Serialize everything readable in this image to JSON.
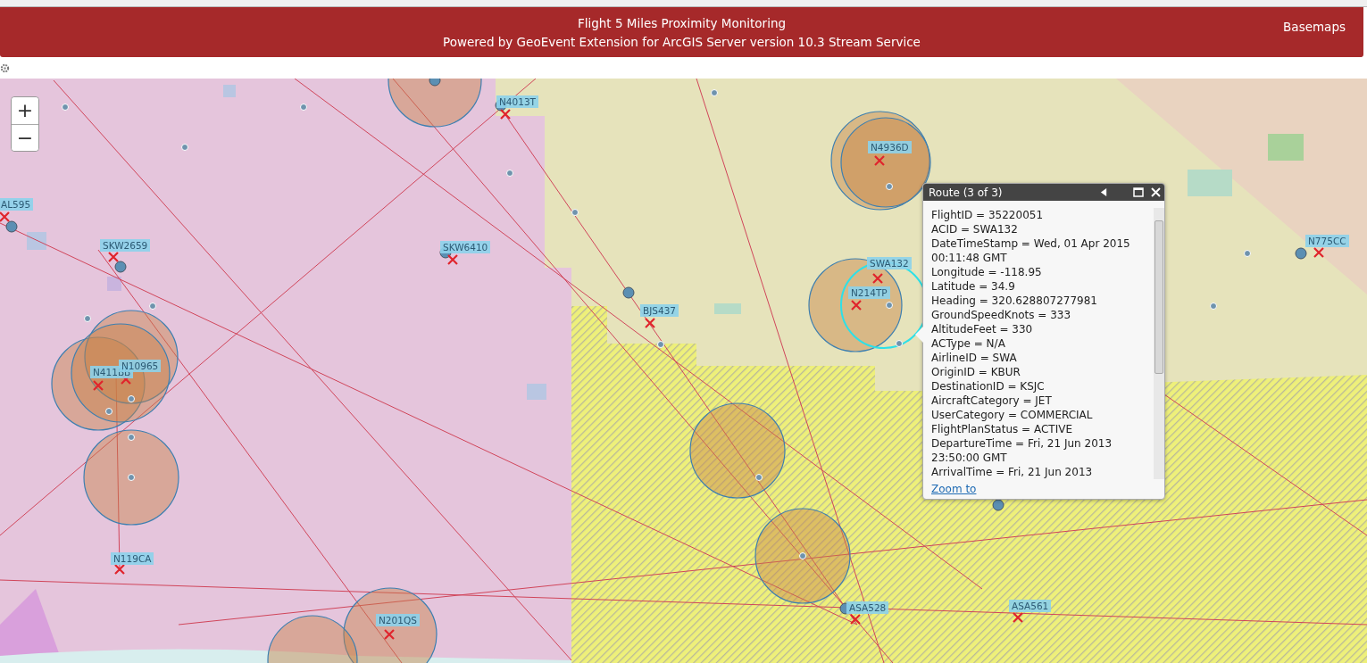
{
  "header": {
    "title": "Flight 5 Miles Proximity Monitoring",
    "subtitle": "Powered by GeoEvent Extension for ArcGIS Server version 10.3 Stream Service",
    "basemaps": "Basemaps"
  },
  "map": {
    "zoom_in": "+",
    "zoom_out": "−",
    "flights": [
      {
        "label": "AL595"
      },
      {
        "label": "SKW2659"
      },
      {
        "label": "SKW6410"
      },
      {
        "label": "N4013T"
      },
      {
        "label": "N4936D"
      },
      {
        "label": "SWA132"
      },
      {
        "label": "N214TP"
      },
      {
        "label": "BJS437"
      },
      {
        "label": "N411BB"
      },
      {
        "label": "N10965"
      },
      {
        "label": "N119CA"
      },
      {
        "label": "N201QS"
      },
      {
        "label": "ASA528"
      },
      {
        "label": "ASA561"
      },
      {
        "label": "N775CC"
      }
    ],
    "popup": {
      "title": "Route (3 of 3)",
      "lines": [
        "FlightID = 35220051",
        "ACID = SWA132",
        "DateTimeStamp = Wed, 01 Apr 2015 00:11:48 GMT",
        "Longitude = -118.95",
        "Latitude = 34.9",
        "Heading = 320.628807277981",
        "GroundSpeedKnots = 333",
        "AltitudeFeet = 330",
        "ACType = N/A",
        "AirlineID = SWA",
        "OriginID = KBUR",
        "DestinationID = KSJC",
        "AircraftCategory = JET",
        "UserCategory = COMMERCIAL",
        "FlightPlanStatus = ACTIVE",
        "DepartureTime = Fri, 21 Jun 2013 23:50:00 GMT",
        "ArrivalTime = Fri, 21 Jun 2013"
      ],
      "link": "Zoom to"
    }
  }
}
